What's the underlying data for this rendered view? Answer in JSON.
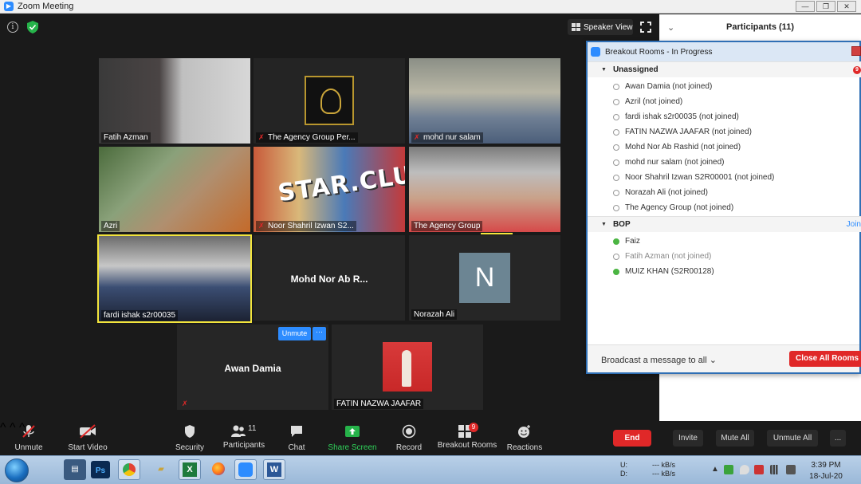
{
  "window": {
    "title": "Zoom Meeting"
  },
  "meeting": {
    "speaker_view_label": "Speaker View",
    "tiles": [
      {
        "name": "Fatih Azman",
        "muted": false
      },
      {
        "name": "The Agency Group Per...",
        "muted": true
      },
      {
        "name": "mohd nur salam",
        "muted": true
      },
      {
        "name": "Azri",
        "muted": false
      },
      {
        "name": "Noor Shahril Izwan S2...",
        "muted": true
      },
      {
        "name": "The Agency Group",
        "muted": false
      },
      {
        "name": "fardi ishak s2r00035",
        "muted": false
      },
      {
        "name": "Mohd Nor Ab R...",
        "muted": false
      },
      {
        "name": "Norazah Ali",
        "muted": false,
        "avatar_letter": "N"
      },
      {
        "name": "Awan Damia",
        "muted": true
      },
      {
        "name": "FATIN NAZWA JAAFAR",
        "muted": false
      }
    ],
    "tile_overlay_text": "STAR.CLUB",
    "unmute_hover_label": "Unmute",
    "more_hover_label": "···"
  },
  "participants_panel": {
    "title": "Participants (11)",
    "invite_label": "Invite",
    "mute_all_label": "Mute All",
    "unmute_all_label": "Unmute All",
    "more_label": "..."
  },
  "breakout_rooms": {
    "title": "Breakout Rooms - In Progress",
    "rooms": [
      {
        "name": "Unassigned",
        "badge": "9",
        "members": [
          {
            "name": "Awan Damia (not joined)",
            "joined": false
          },
          {
            "name": "Azril (not joined)",
            "joined": false
          },
          {
            "name": "fardi ishak s2r00035 (not joined)",
            "joined": false
          },
          {
            "name": "FATIN NAZWA JAAFAR (not joined)",
            "joined": false
          },
          {
            "name": "Mohd Nor Ab Rashid (not joined)",
            "joined": false
          },
          {
            "name": "mohd nur salam (not joined)",
            "joined": false
          },
          {
            "name": "Noor Shahril Izwan S2R00001 (not joined)",
            "joined": false
          },
          {
            "name": "Norazah Ali (not joined)",
            "joined": false
          },
          {
            "name": "The Agency Group (not joined)",
            "joined": false
          }
        ]
      },
      {
        "name": "BOP",
        "join_label": "Join",
        "members": [
          {
            "name": "Faiz",
            "joined": true
          },
          {
            "name": "Fatih Azman (not joined)",
            "joined": false
          },
          {
            "name": "MUIZ KHAN (S2R00128)",
            "joined": true
          }
        ]
      }
    ],
    "broadcast_label": "Broadcast a message to all",
    "close_all_label": "Close All Rooms"
  },
  "controls": {
    "unmute": "Unmute",
    "start_video": "Start Video",
    "security": "Security",
    "participants": "Participants",
    "participants_count": "11",
    "chat": "Chat",
    "share_screen": "Share Screen",
    "record": "Record",
    "breakout_rooms": "Breakout Rooms",
    "breakout_badge": "9",
    "reactions": "Reactions",
    "end": "End"
  },
  "taskbar": {
    "apps": [
      "Ps",
      "X",
      "W"
    ],
    "net_up_label": "U:",
    "net_down_label": "D:",
    "net_up_value": "--- kB/s",
    "net_down_value": "--- kB/s",
    "time": "3:39 PM",
    "date": "18-Jul-20"
  },
  "colors": {
    "accent": "#2d8cff",
    "danger": "#e02828",
    "active_speaker": "#f3e53c",
    "share_green": "#26b34a"
  }
}
